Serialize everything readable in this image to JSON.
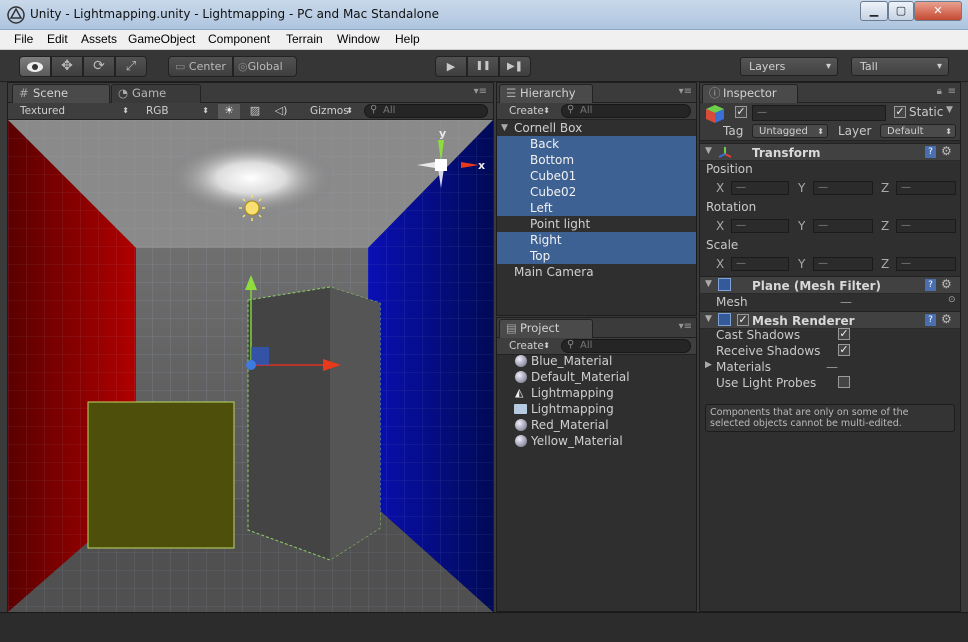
{
  "window": {
    "title": "Unity - Lightmapping.unity - Lightmapping - PC and Mac Standalone",
    "minimize": "▁",
    "maximize": "▢",
    "close": "✕"
  },
  "menu": [
    "File",
    "Edit",
    "Assets",
    "GameObject",
    "Component",
    "Terrain",
    "Window",
    "Help"
  ],
  "toolbar": {
    "tools": [
      "view-tool",
      "move-tool",
      "rotate-tool",
      "scale-tool"
    ],
    "pivot_mode": "Center",
    "pivot_rotation": "Global",
    "play": "▶",
    "pause": "❚❚",
    "step": "▶❚",
    "layers": "Layers",
    "layout": "Tall"
  },
  "scene": {
    "tab_scene": "Scene",
    "tab_game": "Game",
    "render_mode": "Textured",
    "color_mode": "RGB",
    "gizmos": "Gizmos",
    "search_placeholder": "All",
    "axis_y": "y",
    "axis_x": "x"
  },
  "hierarchy": {
    "tab": "Hierarchy",
    "create": "Create",
    "search_placeholder": "All",
    "root": "Cornell Box",
    "children": [
      {
        "label": "Back",
        "selected": true
      },
      {
        "label": "Bottom",
        "selected": true
      },
      {
        "label": "Cube01",
        "selected": true
      },
      {
        "label": "Cube02",
        "selected": true
      },
      {
        "label": "Left",
        "selected": true
      },
      {
        "label": "Point light",
        "selected": false
      },
      {
        "label": "Right",
        "selected": true
      },
      {
        "label": "Top",
        "selected": true
      }
    ],
    "other": "Main Camera"
  },
  "project": {
    "tab": "Project",
    "create": "Create",
    "search_placeholder": "All",
    "items": [
      {
        "label": "Blue_Material",
        "icon": "material-icon"
      },
      {
        "label": "Default_Material",
        "icon": "material-icon"
      },
      {
        "label": "Lightmapping",
        "icon": "unity-scene-icon"
      },
      {
        "label": "Lightmapping",
        "icon": "folder-icon"
      },
      {
        "label": "Red_Material",
        "icon": "material-icon"
      },
      {
        "label": "Yellow_Material",
        "icon": "material-icon"
      }
    ]
  },
  "inspector": {
    "tab": "Inspector",
    "name_value": "—",
    "static_label": "Static",
    "tag_label": "Tag",
    "tag_value": "Untagged",
    "layer_label": "Layer",
    "layer_value": "Default",
    "transform": {
      "title": "Transform",
      "position": "Position",
      "rotation": "Rotation",
      "scale": "Scale",
      "x": "X",
      "y": "Y",
      "z": "Z",
      "mixed": "—"
    },
    "mesh_filter": {
      "title": "Plane (Mesh Filter)",
      "mesh_label": "Mesh",
      "mesh_value": "—"
    },
    "mesh_renderer": {
      "title": "Mesh Renderer",
      "cast_shadows": "Cast Shadows",
      "receive_shadows": "Receive Shadows",
      "materials": "Materials",
      "materials_value": "—",
      "use_light_probes": "Use Light Probes"
    },
    "note": "Components that are only on some of the selected objects cannot be multi-edited."
  }
}
